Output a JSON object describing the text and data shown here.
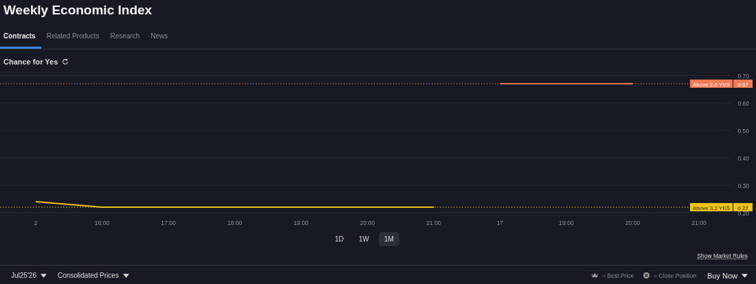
{
  "title": "Weekly Economic Index",
  "tabs": [
    {
      "label": "Contracts",
      "selected": true
    },
    {
      "label": "Related Products",
      "selected": false
    },
    {
      "label": "Research",
      "selected": false
    },
    {
      "label": "News",
      "selected": false
    }
  ],
  "chart_header": {
    "title": "Chance for Yes"
  },
  "chart_data": {
    "type": "line",
    "categories": [
      "2",
      "16:00",
      "17:00",
      "18:00",
      "19:00",
      "20:00",
      "21:00",
      "17",
      "19:00",
      "20:00",
      "21:00"
    ],
    "ylim": [
      0.2,
      0.7
    ],
    "yticks": [
      {
        "value": 0.2,
        "label": "0.20"
      },
      {
        "value": 0.3,
        "label": "0.30"
      },
      {
        "value": 0.4,
        "label": "0.40"
      },
      {
        "value": 0.5,
        "label": "0.50"
      },
      {
        "value": 0.6,
        "label": "0.60"
      },
      {
        "value": 0.7,
        "label": "0.70"
      }
    ],
    "grid": true,
    "legend": true,
    "series": [
      {
        "name": "Above 2.6 YES",
        "color": "#f07a56",
        "values": [
          null,
          null,
          null,
          null,
          null,
          null,
          null,
          0.67,
          0.67,
          0.67,
          null
        ]
      },
      {
        "name": "Above 3.2 YES",
        "color": "#f0c419",
        "values": [
          0.24,
          0.22,
          0.22,
          0.22,
          0.22,
          0.22,
          0.22,
          null,
          null,
          null,
          null
        ]
      }
    ],
    "ref_lines": [
      {
        "axis": "y",
        "value": 0.67,
        "color": "#f07a56",
        "label": "0.67"
      },
      {
        "axis": "y",
        "value": 0.22,
        "color": "#f0c419",
        "label": "0.22"
      }
    ]
  },
  "ranges": [
    {
      "label": "1D",
      "selected": false
    },
    {
      "label": "1W",
      "selected": false
    },
    {
      "label": "1M",
      "selected": true
    }
  ],
  "market_rules_link": "Show Market Rules",
  "footer": {
    "date": "Jul25'26",
    "prices": "Consolidated Prices",
    "legend_best": "= Best Price",
    "legend_close": "= Close Position",
    "buy": "Buy Now"
  }
}
